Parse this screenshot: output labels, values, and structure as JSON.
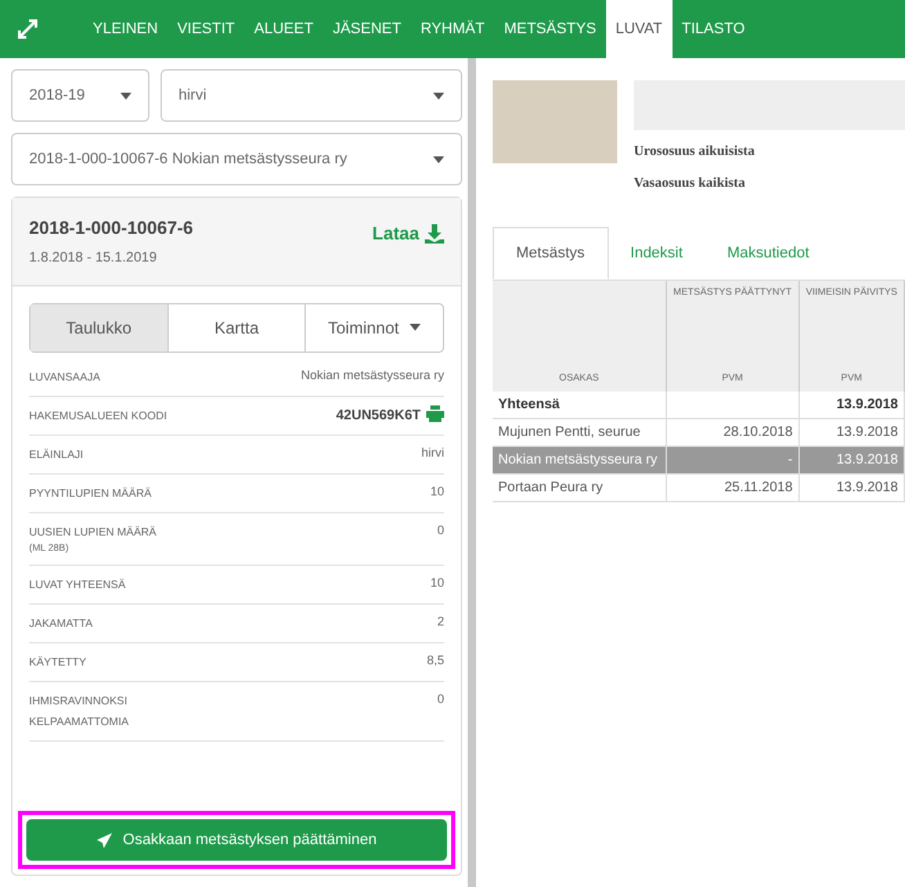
{
  "nav": {
    "tabs": [
      {
        "label": "YLEINEN",
        "selected": false
      },
      {
        "label": "VIESTIT",
        "selected": false
      },
      {
        "label": "ALUEET",
        "selected": false
      },
      {
        "label": "JÄSENET",
        "selected": false
      },
      {
        "label": "RYHMÄT",
        "selected": false
      },
      {
        "label": "METSÄSTYS",
        "selected": false
      },
      {
        "label": "LUVAT",
        "selected": true
      },
      {
        "label": "TILASTO",
        "selected": false
      }
    ]
  },
  "filters": {
    "season": "2018-19",
    "species": "hirvi",
    "permit": "2018-1-000-10067-6 Nokian metsästysseura ry"
  },
  "permit": {
    "number": "2018-1-000-10067-6",
    "dates": "1.8.2018 - 15.1.2019",
    "download": "Lataa",
    "view_tabs": [
      {
        "label": "Taulukko",
        "selected": true
      },
      {
        "label": "Kartta",
        "selected": false
      }
    ],
    "actions": "Toiminnot",
    "details": [
      {
        "label": "LUVANSAAJA",
        "value": "Nokian metsästysseura ry"
      },
      {
        "label": "HAKEMUSALUEEN KOODI",
        "value": "42UN569K6T",
        "kind": "code"
      },
      {
        "label": "ELÄINLAJI",
        "value": "hirvi"
      },
      {
        "label": "PYYNTILUPIEN MÄÄRÄ",
        "value": "10"
      },
      {
        "label": "UUSIEN LUPIEN MÄÄRÄ",
        "note": "(ML 28B)",
        "value": "0"
      },
      {
        "label": "LUVAT YHTEENSÄ",
        "value": "10"
      },
      {
        "label": "JAKAMATTA",
        "value": "2"
      },
      {
        "label": "KÄYTETTY",
        "value": "8,5"
      },
      {
        "label": "IHMISRAVINNOKSI KELPAAMATTOMIA",
        "value": "0"
      }
    ],
    "end_button": {
      "label": "Osakkaan metsästyksen päättäminen",
      "highlighted": true
    }
  },
  "summary": {
    "rows": [
      "Urososuus aikuisista",
      "Vasaosuus kaikista"
    ]
  },
  "tabs": [
    {
      "label": "Metsästys",
      "selected": true
    },
    {
      "label": "Indeksit",
      "selected": false
    },
    {
      "label": "Maksutiedot",
      "selected": false
    }
  ],
  "table": {
    "columns": [
      {
        "sub": "OSAKAS"
      },
      {
        "title": "METSÄSTYS PÄÄTTYNYT",
        "sub": "PVM"
      },
      {
        "title": "VIIMEISIN PÄIVITYS",
        "sub": "PVM"
      }
    ],
    "rows": [
      {
        "cells": [
          "Yhteensä",
          "",
          "13.9.2018"
        ],
        "bold": true,
        "selected": false
      },
      {
        "cells": [
          "Mujunen Pentti, seurue",
          "28.10.2018",
          "13.9.2018"
        ],
        "bold": false,
        "selected": false
      },
      {
        "cells": [
          "Nokian metsästysseura ry",
          "-",
          "13.9.2018"
        ],
        "bold": false,
        "selected": true
      },
      {
        "cells": [
          "Portaan Peura ry",
          "25.11.2018",
          "13.9.2018"
        ],
        "bold": false,
        "selected": false
      }
    ]
  }
}
